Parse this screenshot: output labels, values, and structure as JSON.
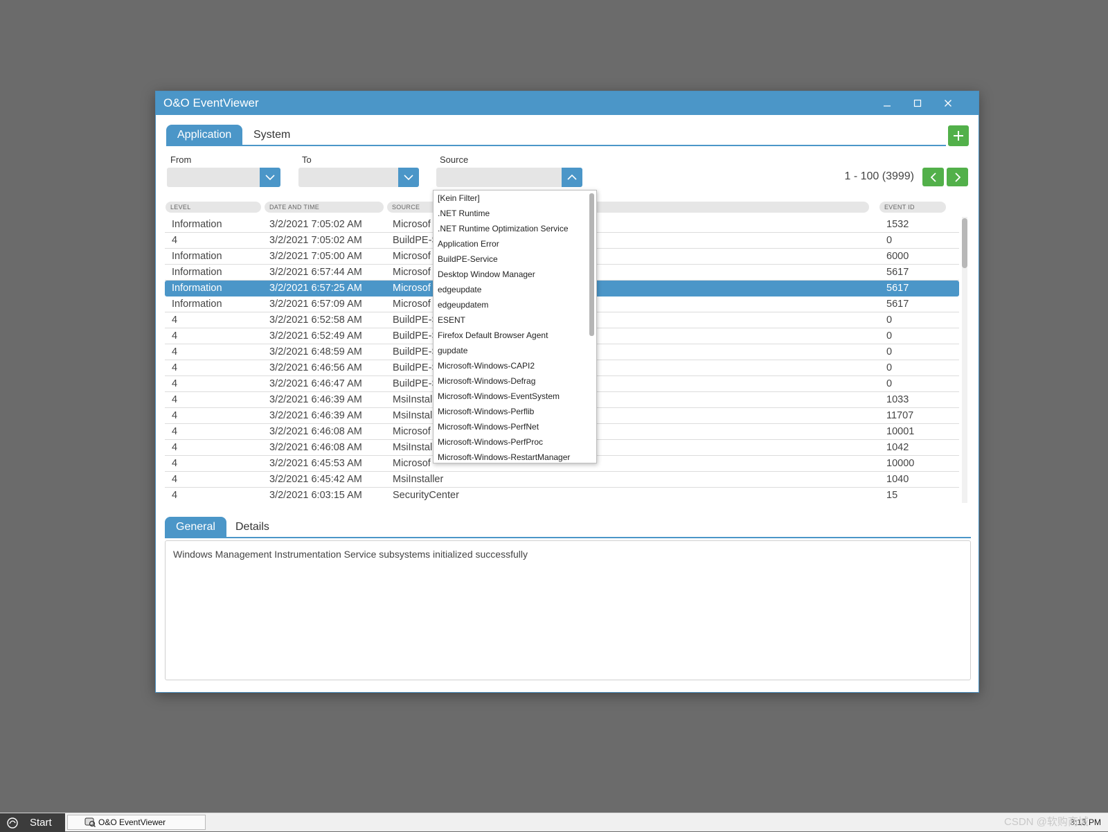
{
  "window": {
    "title": "O&O EventViewer"
  },
  "top_tabs": [
    {
      "label": "Application",
      "active": true
    },
    {
      "label": "System",
      "active": false
    }
  ],
  "filters": {
    "from_label": "From",
    "to_label": "To",
    "source_label": "Source",
    "from_value": "",
    "to_value": "",
    "source_value": ""
  },
  "paging": {
    "text": "1 - 100 (3999)"
  },
  "columns": {
    "level": "LEVEL",
    "date": "DATE AND TIME",
    "source": "SOURCE",
    "event_id": "EVENT ID"
  },
  "rows": [
    {
      "level": "Information",
      "date": "3/2/2021 7:05:02 AM",
      "source": "Microsof",
      "id": "1532"
    },
    {
      "level": "4",
      "date": "3/2/2021 7:05:02 AM",
      "source": "BuildPE-S",
      "id": "0"
    },
    {
      "level": "Information",
      "date": "3/2/2021 7:05:00 AM",
      "source": "Microsof",
      "id": "6000"
    },
    {
      "level": "Information",
      "date": "3/2/2021 6:57:44 AM",
      "source": "Microsof",
      "id": "5617"
    },
    {
      "level": "Information",
      "date": "3/2/2021 6:57:25 AM",
      "source": "Microsof",
      "id": "5617",
      "selected": true
    },
    {
      "level": "Information",
      "date": "3/2/2021 6:57:09 AM",
      "source": "Microsof",
      "id": "5617"
    },
    {
      "level": "4",
      "date": "3/2/2021 6:52:58 AM",
      "source": "BuildPE-S",
      "id": "0"
    },
    {
      "level": "4",
      "date": "3/2/2021 6:52:49 AM",
      "source": "BuildPE-S",
      "id": "0"
    },
    {
      "level": "4",
      "date": "3/2/2021 6:48:59 AM",
      "source": "BuildPE-S",
      "id": "0"
    },
    {
      "level": "4",
      "date": "3/2/2021 6:46:56 AM",
      "source": "BuildPE-S",
      "id": "0"
    },
    {
      "level": "4",
      "date": "3/2/2021 6:46:47 AM",
      "source": "BuildPE-S",
      "id": "0"
    },
    {
      "level": "4",
      "date": "3/2/2021 6:46:39 AM",
      "source": "MsiInstal",
      "id": "1033"
    },
    {
      "level": "4",
      "date": "3/2/2021 6:46:39 AM",
      "source": "MsiInstal",
      "id": "11707"
    },
    {
      "level": "4",
      "date": "3/2/2021 6:46:08 AM",
      "source": "Microsof",
      "id": "10001"
    },
    {
      "level": "4",
      "date": "3/2/2021 6:46:08 AM",
      "source": "MsiInstal",
      "id": "1042"
    },
    {
      "level": "4",
      "date": "3/2/2021 6:45:53 AM",
      "source": "Microsof",
      "id": "10000"
    },
    {
      "level": "4",
      "date": "3/2/2021 6:45:42 AM",
      "source": "MsiInstaller",
      "id": "1040"
    },
    {
      "level": "4",
      "date": "3/2/2021 6:03:15 AM",
      "source": "SecurityCenter",
      "id": "15"
    }
  ],
  "source_dropdown": [
    "[Kein Filter]",
    ".NET Runtime",
    ".NET Runtime Optimization Service",
    "Application Error",
    "BuildPE-Service",
    "Desktop Window Manager",
    "edgeupdate",
    "edgeupdatem",
    "ESENT",
    "Firefox Default Browser Agent",
    "gupdate",
    "Microsoft-Windows-CAPI2",
    "Microsoft-Windows-Defrag",
    "Microsoft-Windows-EventSystem",
    "Microsoft-Windows-Perflib",
    "Microsoft-Windows-PerfNet",
    "Microsoft-Windows-PerfProc",
    "Microsoft-Windows-RestartManager"
  ],
  "bottom_tabs": [
    {
      "label": "General",
      "active": true
    },
    {
      "label": "Details",
      "active": false
    }
  ],
  "detail": {
    "text": "Windows Management Instrumentation Service subsystems initialized successfully"
  },
  "taskbar": {
    "start_label": "Start",
    "task_label": "O&O EventViewer",
    "clock": "3:13 PM"
  },
  "watermark": "CSDN @软购商城",
  "colors": {
    "accent": "#4b96c8",
    "green": "#52b04a",
    "desktop": "#6b6b6b"
  }
}
